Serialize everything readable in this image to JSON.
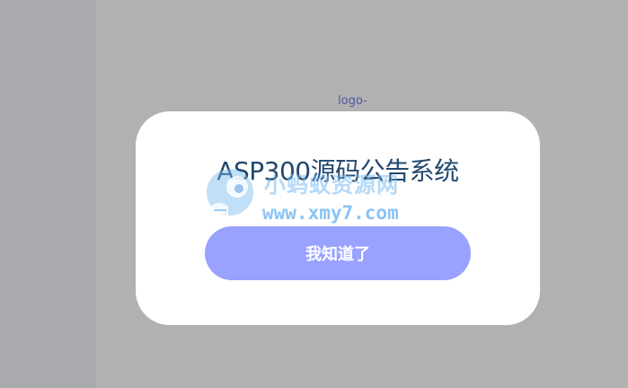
{
  "background": {
    "overlay_color": "#b1b1b1",
    "left_strip_color": "#a9aaad"
  },
  "logo_alt": "logo-",
  "modal": {
    "title": "ASP300源码公告系统",
    "confirm_button": "我知道了",
    "button_color": "#99a2ff",
    "title_color": "#22486e"
  },
  "watermark": {
    "name": "小蚂蚁资源网",
    "url": "www.xmy7.com",
    "icon": "ant-mascot-icon"
  }
}
